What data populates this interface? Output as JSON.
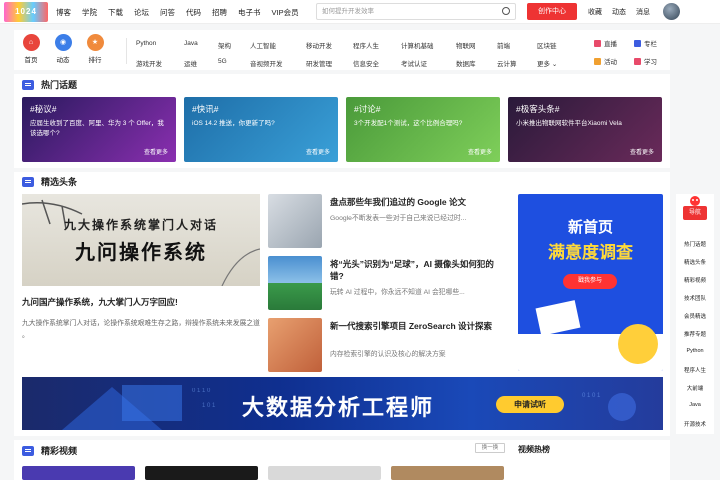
{
  "header": {
    "logo": "1024",
    "nav": [
      "博客",
      "学院",
      "下载",
      "论坛",
      "问答",
      "代码",
      "招聘",
      "电子书",
      "VIP会员"
    ],
    "vip_badge": "新",
    "search_placeholder": "如何提升开发效率",
    "create_label": "创作中心",
    "right": [
      "收藏",
      "动态",
      "消息"
    ]
  },
  "quick": {
    "items": [
      {
        "label": "首页",
        "color": "#e8453c"
      },
      {
        "label": "动态",
        "color": "#3c7ee8"
      },
      {
        "label": "排行",
        "color": "#f08a3c"
      }
    ],
    "cats_row1": [
      "Python",
      "Java",
      "架构",
      "人工智能",
      "移动开发",
      "程序人生",
      "计算机基础",
      "物联网",
      "前端",
      "区块链"
    ],
    "cats_row2": [
      "游戏开发",
      "运维",
      "5G",
      "音视频开发",
      "研发管理",
      "信息安全",
      "考试认证",
      "数据库",
      "云计算",
      "更多"
    ],
    "right_row1": [
      {
        "label": "直播",
        "color": "#e84a6a"
      },
      {
        "label": "专栏",
        "color": "#3c5ce0"
      }
    ],
    "right_row2": [
      {
        "label": "活动",
        "color": "#f0a030"
      },
      {
        "label": "学习",
        "color": "#e84a6a"
      }
    ]
  },
  "hot": {
    "title": "热门话题",
    "more": "查看更多",
    "cards": [
      {
        "tag": "#秘议#",
        "desc": "应届生收到了百度、阿里、华为 3 个 Offer，我该选哪个?",
        "colors": [
          "#2a1a5e",
          "#8a2fb0"
        ]
      },
      {
        "tag": "#快讯#",
        "desc": "iOS 14.2 推送，你更新了吗?",
        "colors": [
          "#1e6ea8",
          "#3aa0d8"
        ]
      },
      {
        "tag": "#讨论#",
        "desc": "3个开发配1个测试，这个比例合理吗?",
        "colors": [
          "#4a9a3a",
          "#7fcf5a"
        ]
      },
      {
        "tag": "#极客头条#",
        "desc": "小米推出物联网软件平台Xiaomi Vela",
        "colors": [
          "#2a1a3a",
          "#6a2a5a"
        ]
      }
    ]
  },
  "featured": {
    "title": "精选头条",
    "big": {
      "img_line1": "九大操作系统掌门人对话",
      "img_line2": "九问操作系统",
      "title": "九问国产操作系统，九大掌门人万字回应!",
      "desc": "九大操作系统掌门人对话，论操作系统艰难生存之路，辩操作系统未来发展之道 。"
    },
    "articles": [
      {
        "title": "盘点那些年我们追过的 Google 论文",
        "desc": "Google不断发表一些对于自己来说已经过时..."
      },
      {
        "title": "将“光头”识别为“足球”，AI 摄像头如何犯的错?",
        "desc": "玩转 AI 过程中，你永远不知道 AI 会犯哪些..."
      },
      {
        "title": "新一代搜索引擎项目 ZeroSearch 设计探索",
        "desc": "内存检索引擎的认识及核心的解决方案"
      }
    ],
    "ad": {
      "line1": "新首页",
      "line2": "满意度调查",
      "button": "戳我参与"
    },
    "banner": {
      "text": "大数据分析工程师",
      "button": "申请试听"
    }
  },
  "video": {
    "title": "精彩视频",
    "swap": "换一换",
    "right_title": "视频热榜"
  },
  "sidebar": {
    "nav": "导航",
    "items": [
      "热门话题",
      "精选头条",
      "精彩视频",
      "技术团队",
      "会员精选",
      "推荐专题",
      "Python",
      "程序人生",
      "大前端",
      "Java",
      "开源技术"
    ]
  }
}
